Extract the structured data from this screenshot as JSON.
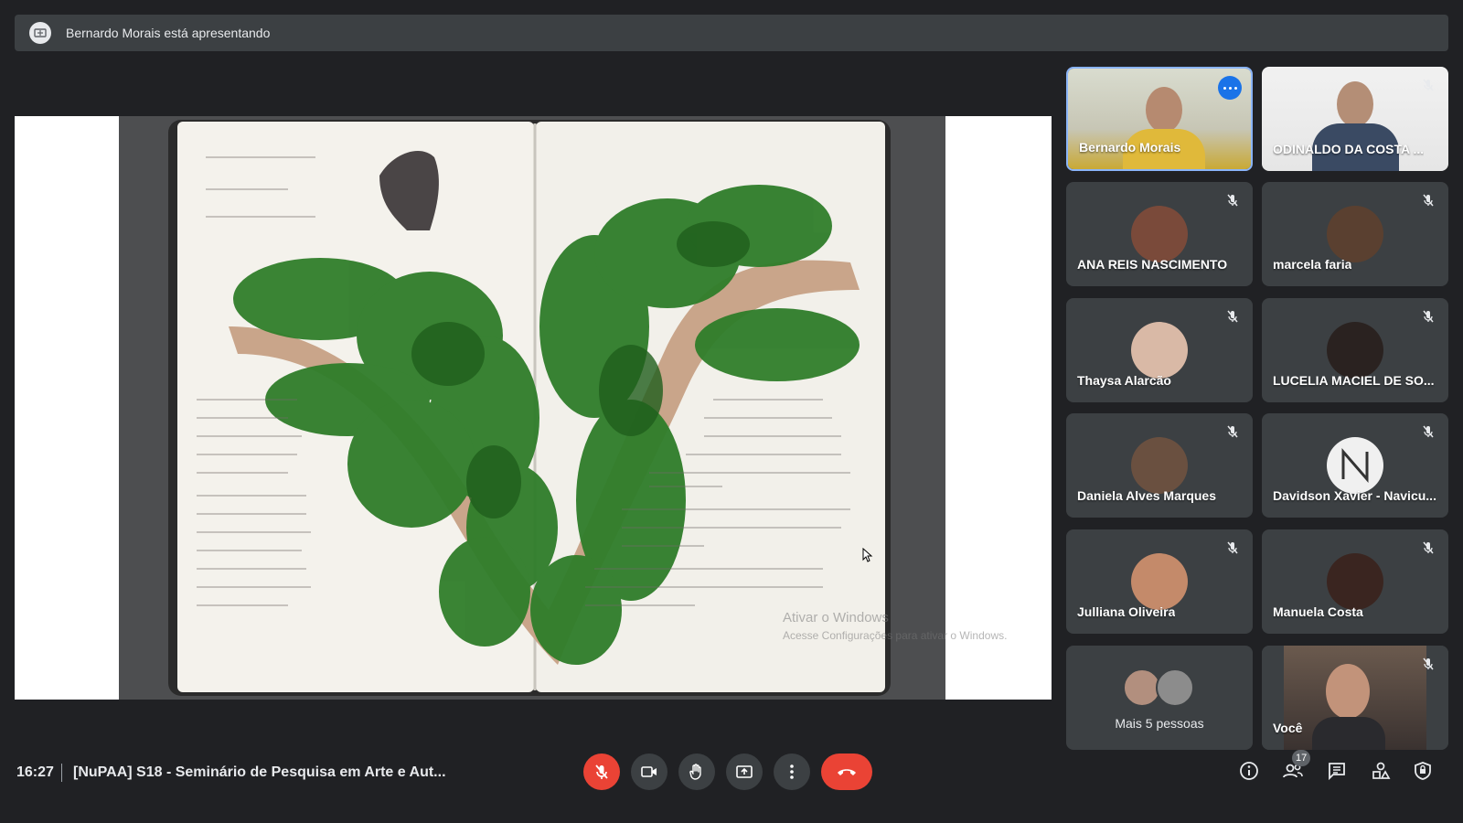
{
  "banner": {
    "text": "Bernardo Morais está apresentando",
    "icon": "presentation-icon"
  },
  "presentation": {
    "notebook_left_title_lines": [
      "Achadouro #01",
      "Fluir, estar",
      "Presença fluida"
    ],
    "notebook_left_text": [
      "O lugar onde",
      "um córrego",
      "encontra um rio",
      "devia ser visitado",
      "por todo mundo!",
      "É tanta sabedoria",
      "aprendida nos mo-",
      "mentos de presença ali",
      "que tenho dúvidas",
      "se uma vida inteira",
      "não poderia acontecer",
      "só estando lá."
    ],
    "notebook_right_text": [
      "Se eu me",
      "desterritorializei do",
      "meu lugar de origem",
      "e infância, de um lugar",
      "real e palpável, agora me",
      "reterritorializei em um lugar",
      "de devaneio.",
      "Realoquei, recodifiquei e remontei",
      "este território em um não-lugar que",
      "é Encantado.",
      "Este achadouro foi cavado neste",
      "lugar entre lugares, portal entre",
      "duas margens."
    ],
    "stream_labels": [
      "Córrego Lagos",
      "rio Acari"
    ],
    "watermark_title": "Ativar o Windows",
    "watermark_sub": "Acesse Configurações para ativar o Windows."
  },
  "participants": [
    {
      "name": "Bernardo Morais",
      "type": "video",
      "active": true
    },
    {
      "name": "ODINALDO DA COSTA ...",
      "type": "video",
      "muted": true
    },
    {
      "name": "ANA REIS NASCIMENTO",
      "type": "avatar",
      "muted": true,
      "color": "#7a4a3a"
    },
    {
      "name": "marcela faria",
      "type": "avatar",
      "muted": true,
      "color": "#5a4030"
    },
    {
      "name": "Thaysa Alarcão",
      "type": "avatar",
      "muted": true,
      "color": "#d9b9a6"
    },
    {
      "name": "LUCELIA MACIEL DE SO...",
      "type": "avatar",
      "muted": true,
      "color": "#2a2220"
    },
    {
      "name": "Daniela Alves Marques",
      "type": "avatar",
      "muted": true,
      "color": "#6a5040"
    },
    {
      "name": "Davidson Xavier - Navicu...",
      "type": "avatar",
      "muted": true,
      "color": "#f0f0f0"
    },
    {
      "name": "Julliana Oliveira",
      "type": "avatar",
      "muted": true,
      "color": "#c48a6a"
    },
    {
      "name": "Manuela Costa",
      "type": "avatar",
      "muted": true,
      "color": "#3a2520"
    },
    {
      "name": "Mais 5 pessoas",
      "type": "others"
    },
    {
      "name": "Você",
      "type": "self",
      "muted": true
    }
  ],
  "bottom": {
    "time": "16:27",
    "title": "[NuPAA] S18 - Seminário de Pesquisa em Arte e Aut...",
    "participant_count": "17",
    "controls": [
      "mic-off-icon",
      "camera-icon",
      "raise-hand-icon",
      "present-screen-icon",
      "more-options-icon",
      "end-call-icon"
    ],
    "side_icons": [
      "info-icon",
      "people-icon",
      "chat-icon",
      "activities-icon",
      "host-controls-icon"
    ]
  },
  "colors": {
    "bg": "#202124",
    "tile": "#3c4043",
    "accent": "#8ab4f8",
    "danger": "#ea4335"
  }
}
